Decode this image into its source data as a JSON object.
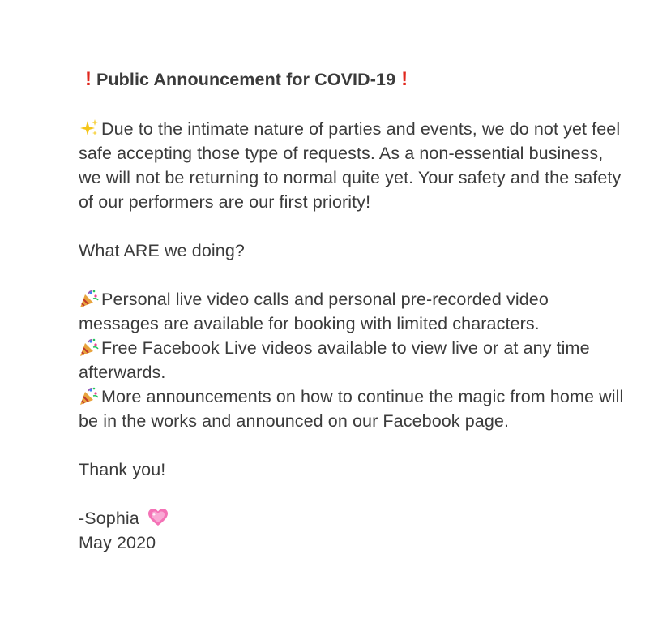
{
  "title": {
    "left_mark": "!",
    "text": "Public Announcement for COVID-19",
    "right_mark": "!"
  },
  "intro": {
    "icon": "sparkles-icon",
    "text": "Due to the intimate nature of parties and events, we do not yet feel safe accepting those type of requests. As a non-essential business, we will not be returning to normal quite yet. Your safety and the safety of our performers are our first priority!"
  },
  "question": "What ARE we doing?",
  "bullets": [
    {
      "icon": "party-popper-icon",
      "text": "Personal live video calls and personal pre-recorded video messages are available for booking with limited characters."
    },
    {
      "icon": "party-popper-icon",
      "text": "Free Facebook Live videos available to view live or at any time afterwards."
    },
    {
      "icon": "party-popper-icon",
      "text": "More announcements on how to continue the magic from home will be in the works and announced on our Facebook page."
    }
  ],
  "thanks": "Thank you!",
  "signature": {
    "name": "-Sophia",
    "icon": "sparkling-heart-icon",
    "date": "May 2020"
  }
}
